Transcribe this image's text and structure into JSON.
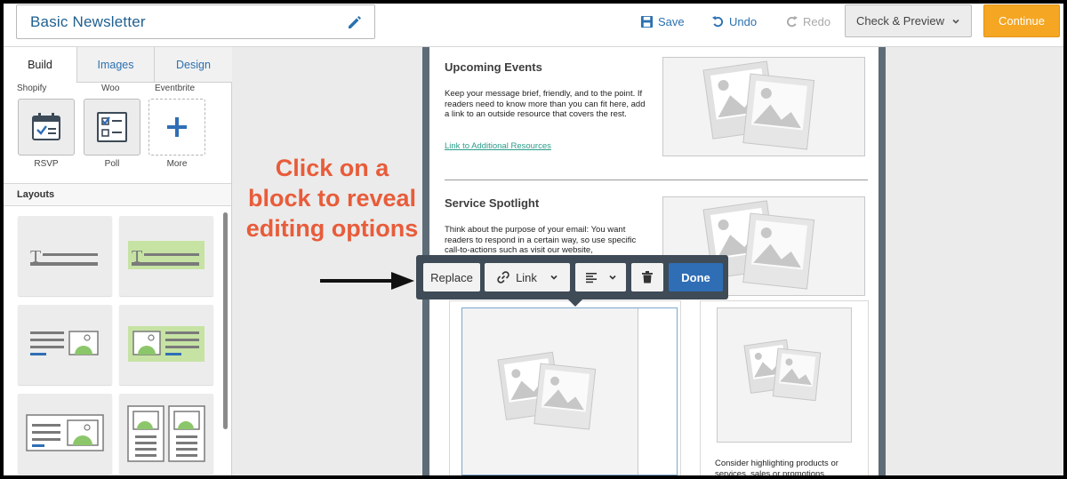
{
  "topbar": {
    "document_title": "Basic Newsletter",
    "save_label": "Save",
    "undo_label": "Undo",
    "redo_label": "Redo",
    "check_preview_label": "Check & Preview",
    "continue_label": "Continue"
  },
  "left_panel": {
    "tabs": [
      {
        "label": "Build",
        "active": true
      },
      {
        "label": "Images",
        "active": false
      },
      {
        "label": "Design",
        "active": false
      }
    ],
    "apps": [
      "Shopify",
      "Woo",
      "Eventbrite"
    ],
    "blocks": [
      {
        "label": "RSVP",
        "icon": "calendar-check-icon"
      },
      {
        "label": "Poll",
        "icon": "poll-checklist-icon"
      },
      {
        "label": "More",
        "icon": "plus-icon"
      }
    ],
    "layouts_heading": "Layouts"
  },
  "canvas": {
    "upcoming_events": {
      "title": "Upcoming Events",
      "body": "Keep your message brief, friendly, and to the point. If readers need to know more than you can fit here, add a link to an outside resource that covers the rest.",
      "link": "Link to Additional Resources"
    },
    "service_spotlight": {
      "title": "Service Spotlight",
      "body": "Think about the purpose of your email: You want readers to respond in a certain way, so use specific call-to-actions such as visit our website,"
    },
    "product_card_text": "Consider highlighting products or services, sales or promotions,"
  },
  "annotation": {
    "callout": "Click on a block to reveal editing options"
  },
  "edit_toolbar": {
    "replace_label": "Replace",
    "link_label": "Link",
    "done_label": "Done"
  },
  "colors": {
    "accent_blue": "#2b71b0",
    "continue_orange": "#f5a623",
    "annotation_red": "#e85c3a",
    "toolbar_dark": "#3f4b56",
    "done_blue": "#2f6eb5"
  }
}
